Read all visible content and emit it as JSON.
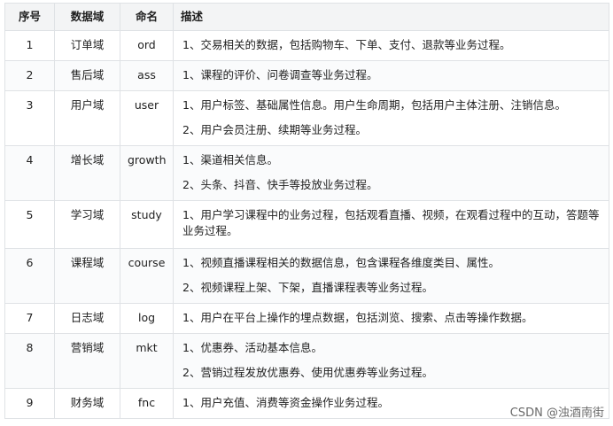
{
  "headers": [
    "序号",
    "数据域",
    "命名",
    "描述"
  ],
  "rows": [
    {
      "no": "1",
      "domain": "订单域",
      "name": "ord",
      "desc": [
        "1、交易相关的数据，包括购物车、下单、支付、退款等业务过程。"
      ]
    },
    {
      "no": "2",
      "domain": "售后域",
      "name": "ass",
      "desc": [
        "1、课程的评价、问卷调查等业务过程。"
      ]
    },
    {
      "no": "3",
      "domain": "用户域",
      "name": "user",
      "desc": [
        "1、用户标签、基础属性信息。用户生命周期，包括用户主体注册、注销信息。",
        "2、用户会员注册、续期等业务过程。"
      ]
    },
    {
      "no": "4",
      "domain": "增长域",
      "name": "growth",
      "desc": [
        "1、渠道相关信息。",
        "2、头条、抖音、快手等投放业务过程。"
      ]
    },
    {
      "no": "5",
      "domain": "学习域",
      "name": "study",
      "desc": [
        "1、用户学习课程中的业务过程，包括观看直播、视频，在观看过程中的互动，答题等业务过程。"
      ]
    },
    {
      "no": "6",
      "domain": "课程域",
      "name": "course",
      "desc": [
        "1、视频直播课程相关的数据信息，包含课程各维度类目、属性。",
        "2、视频课程上架、下架，直播课程表等业务过程。"
      ]
    },
    {
      "no": "7",
      "domain": "日志域",
      "name": "log",
      "desc": [
        "1、用户在平台上操作的埋点数据，包括浏览、搜索、点击等操作数据。"
      ]
    },
    {
      "no": "8",
      "domain": "营销域",
      "name": "mkt",
      "desc": [
        "1、优惠券、活动基本信息。",
        "2、营销过程发放优惠券、使用优惠券等业务过程。"
      ]
    },
    {
      "no": "9",
      "domain": "财务域",
      "name": "fnc",
      "desc": [
        "1、用户充值、消费等资金操作业务过程。"
      ]
    }
  ],
  "watermark": "CSDN @浊酒南街"
}
